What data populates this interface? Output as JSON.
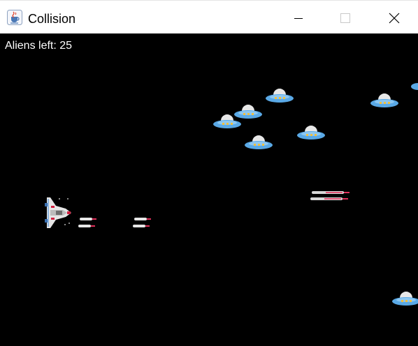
{
  "window": {
    "title": "Collision",
    "icon": "java-cup-icon",
    "controls": [
      "minimize-icon",
      "maximize-icon",
      "close-icon"
    ]
  },
  "hud": {
    "aliens_left_label": "Aliens left: 25"
  },
  "colors": {
    "background": "#000000",
    "hud_text": "#ffffff",
    "alien_saucer": "#5aa9e6",
    "alien_dome": "#e8e8e8",
    "missile_tip": "#e0305a"
  },
  "sprites": {
    "player": "spaceship-icon",
    "aliens": "ufo-icon",
    "missiles": "missile-icon"
  }
}
